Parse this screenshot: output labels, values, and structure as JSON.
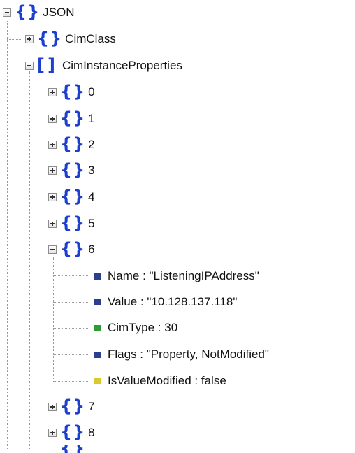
{
  "tree": {
    "root": {
      "label": "JSON"
    },
    "cim_class": {
      "label": "CimClass"
    },
    "cim_instance_properties": {
      "label": "CimInstanceProperties",
      "items": [
        {
          "label": "0"
        },
        {
          "label": "1"
        },
        {
          "label": "2"
        },
        {
          "label": "3"
        },
        {
          "label": "4"
        },
        {
          "label": "5"
        },
        {
          "label": "6"
        },
        {
          "label": "7"
        },
        {
          "label": "8"
        }
      ],
      "expanded_item": {
        "properties": [
          {
            "text": "Name : \"ListeningIPAddress\"",
            "color": "#2b3f8f"
          },
          {
            "text": "Value : \"10.128.137.118\"",
            "color": "#2b3f8f"
          },
          {
            "text": "CimType : 30",
            "color": "#2e9b35"
          },
          {
            "text": "Flags : \"Property, NotModified\"",
            "color": "#2b3f8f"
          },
          {
            "text": "IsValueModified : false",
            "color": "#d9c92b"
          }
        ]
      }
    }
  },
  "colors": {
    "brace_blue": "#1d3fcf",
    "string_square": "#2b3f8f",
    "number_square": "#2e9b35",
    "boolean_square": "#d9c92b"
  }
}
